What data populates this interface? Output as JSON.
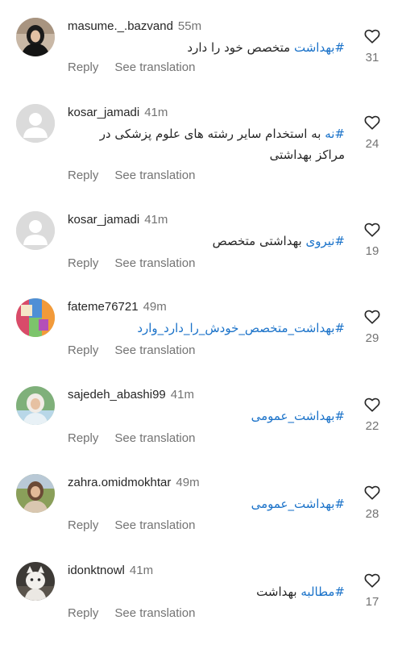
{
  "actions": {
    "reply_label": "Reply",
    "translate_label": "See translation"
  },
  "comments": [
    {
      "username": "masume._.bazvand",
      "time": "55m",
      "hashtag": "#بهداشت",
      "text": " متخصص خود را دارد",
      "likes": "31",
      "avatar": "photo-woman-black-hijab"
    },
    {
      "username": "kosar_jamadi",
      "time": "41m",
      "hashtag": "#نه",
      "text": " به استخدام سایر رشته های علوم پزشکی در مراکز بهداشتی",
      "likes": "24",
      "avatar": "default-person-icon"
    },
    {
      "username": "kosar_jamadi",
      "time": "41m",
      "hashtag": "#نیروی",
      "text": " بهداشتی متخصص",
      "likes": "19",
      "avatar": "default-person-icon"
    },
    {
      "username": "fateme76721",
      "time": "49m",
      "hashtag": "#بهداشت_متخصص_خودش_را_دارد_وارد",
      "text": "",
      "likes": "29",
      "avatar": "photo-colorful-collage"
    },
    {
      "username": "sajedeh_abashi99",
      "time": "41m",
      "hashtag": "#بهداشت_عمومی",
      "text": "",
      "likes": "22",
      "avatar": "photo-woman-light-hijab"
    },
    {
      "username": "zahra.omidmokhtar",
      "time": "49m",
      "hashtag": "#بهداشت_عمومی",
      "text": "",
      "likes": "28",
      "avatar": "photo-woman-outdoors"
    },
    {
      "username": "idonktnowl",
      "time": "41m",
      "hashtag": "#مطالبه",
      "text": " بهداشت",
      "likes": "17",
      "avatar": "photo-white-cat"
    }
  ],
  "colors": {
    "hashtag": "#1a72c9",
    "muted": "#737373",
    "text": "#262626"
  }
}
